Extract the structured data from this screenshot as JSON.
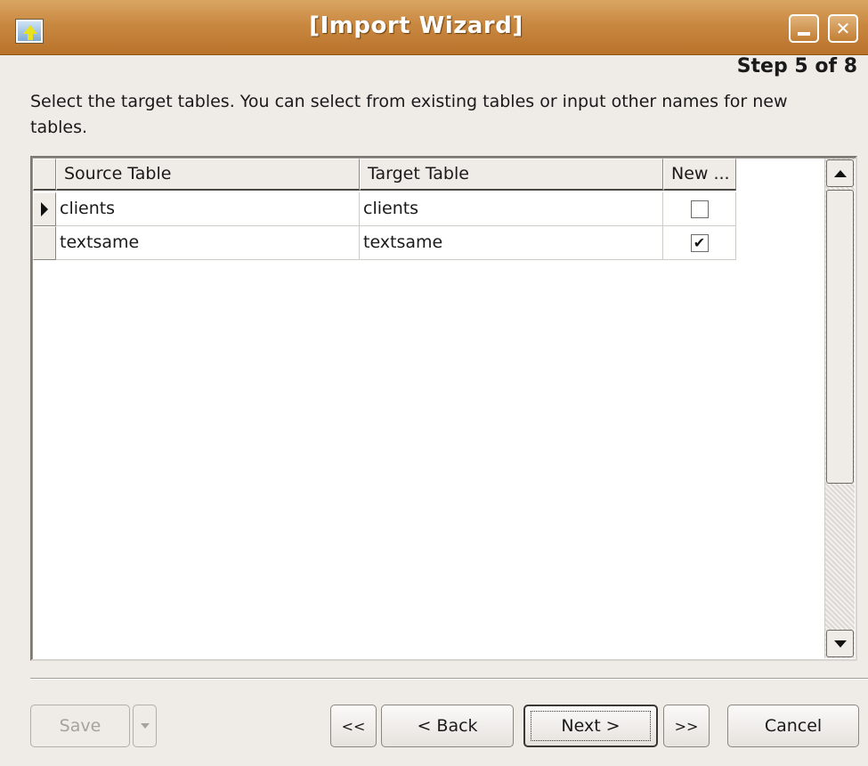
{
  "window": {
    "title": "[Import Wizard]",
    "step": "Step 5 of 8",
    "instruction": "Select the target tables. You can select from existing tables or input other names for new tables."
  },
  "grid": {
    "columns": [
      "Source Table",
      "Target Table",
      "New ..."
    ],
    "rows": [
      {
        "source": "clients",
        "target": "clients",
        "new": false,
        "current": true
      },
      {
        "source": "textsame",
        "target": "textsame",
        "new": true,
        "current": false
      }
    ]
  },
  "buttons": {
    "save": "Save",
    "first": "<<",
    "back": "< Back",
    "next": "Next >",
    "last": ">>",
    "cancel": "Cancel"
  },
  "icons": {
    "app": "import-icon",
    "minimize": "minimize-icon",
    "close": "close-icon",
    "row_pointer": "row-pointer-icon",
    "scroll_up": "scroll-up-arrow-icon",
    "scroll_down": "scroll-down-arrow-icon",
    "dropdown": "chevron-down-icon",
    "check": "checkmark-icon"
  },
  "glyphs": {
    "close": "✕",
    "check": "✔"
  }
}
